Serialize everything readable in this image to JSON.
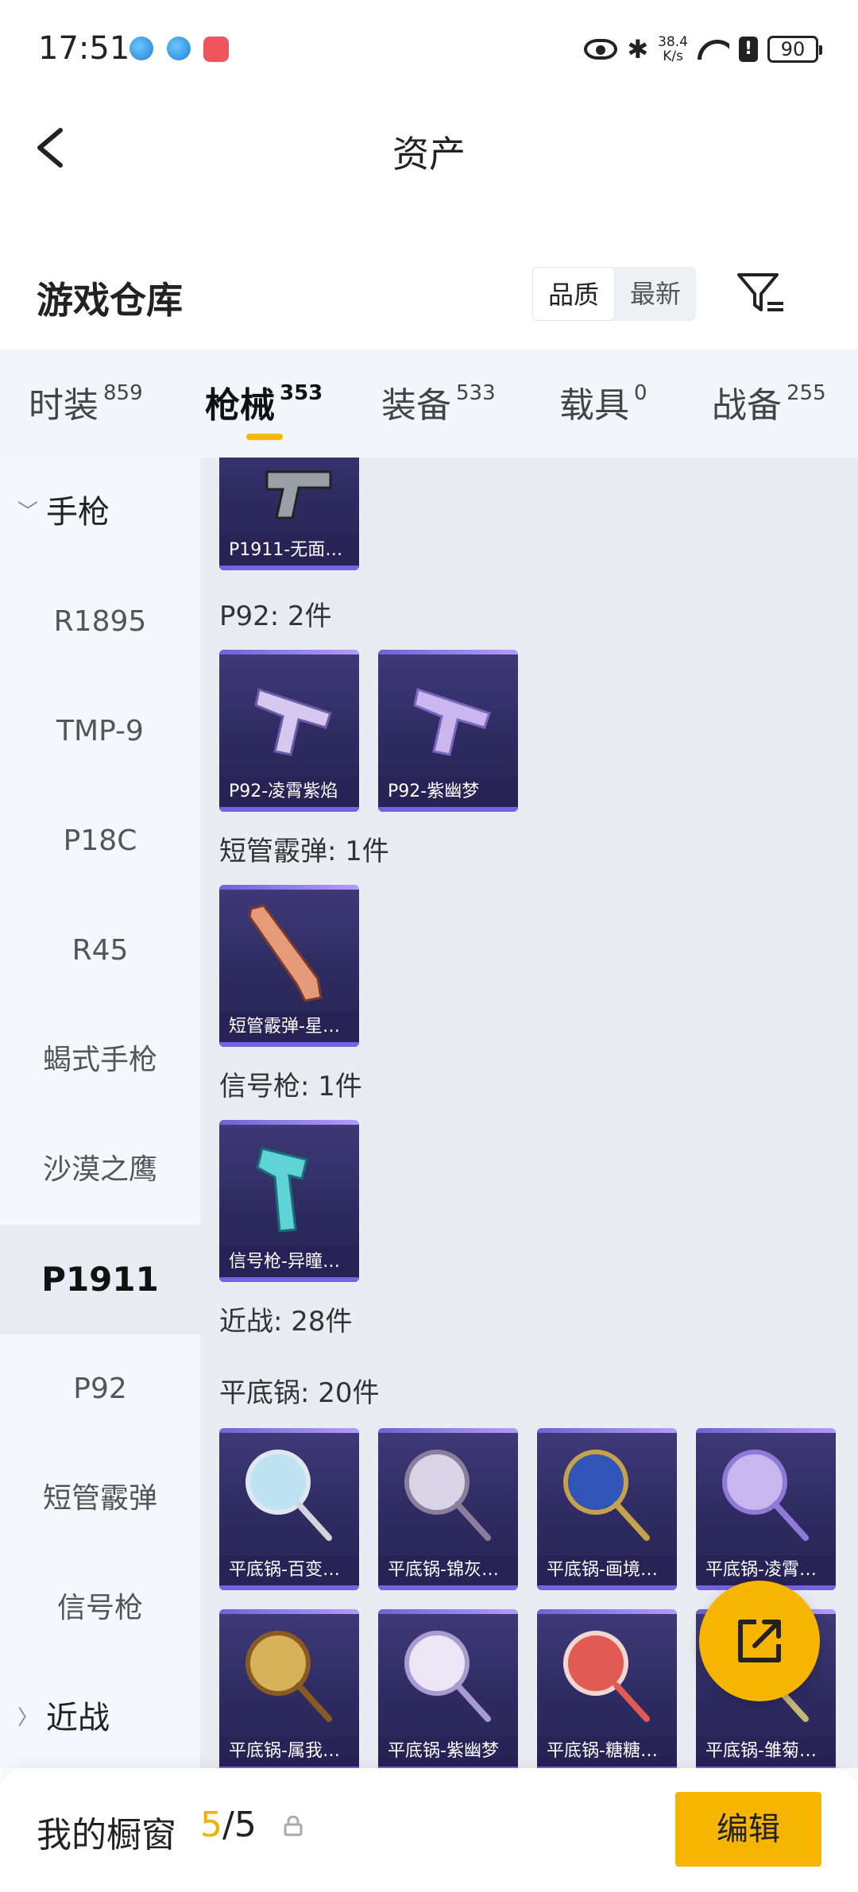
{
  "status_bar": {
    "time": "17:51",
    "speed_value": "38.4",
    "speed_unit": "K/s",
    "alert": "!",
    "battery": "90"
  },
  "header": {
    "title": "资产"
  },
  "warehouse": {
    "title": "游戏仓库",
    "sort_options": [
      "品质",
      "最新"
    ],
    "sort_selected": "品质"
  },
  "tabs": [
    {
      "label": "时装",
      "count": "859"
    },
    {
      "label": "枪械",
      "count": "353",
      "active": true
    },
    {
      "label": "装备",
      "count": "533"
    },
    {
      "label": "载具",
      "count": "0"
    },
    {
      "label": "战备",
      "count": "255"
    }
  ],
  "sidebar": {
    "items": [
      "手枪",
      "R1895",
      "TMP-9",
      "P18C",
      "R45",
      "蝎式手枪",
      "沙漠之鹰",
      "P1911",
      "P92",
      "短管霰弹",
      "信号枪",
      "近战"
    ],
    "active": "P1911"
  },
  "content": {
    "sections": [
      {
        "label": "P92: 2件"
      },
      {
        "label": "短管霰弹: 1件"
      },
      {
        "label": "信号枪: 1件"
      },
      {
        "label": "近战: 28件"
      },
      {
        "label": "平底锅: 20件"
      }
    ],
    "cards": [
      "P1911-无面…",
      "P92-凌霄紫焰",
      "P92-紫幽梦",
      "短管霰弹-星…",
      "信号枪-异瞳…",
      "平底锅-百变…",
      "平底锅-锦灰…",
      "平底锅-画境…",
      "平底锅-凌霄…",
      "平底锅-属我…",
      "平底锅-紫幽梦",
      "平底锅-糖糖…",
      "平底锅-雏菊…"
    ]
  },
  "bottom_bar": {
    "title": "我的橱窗",
    "current": "5",
    "total": "/5",
    "edit_label": "编辑"
  }
}
